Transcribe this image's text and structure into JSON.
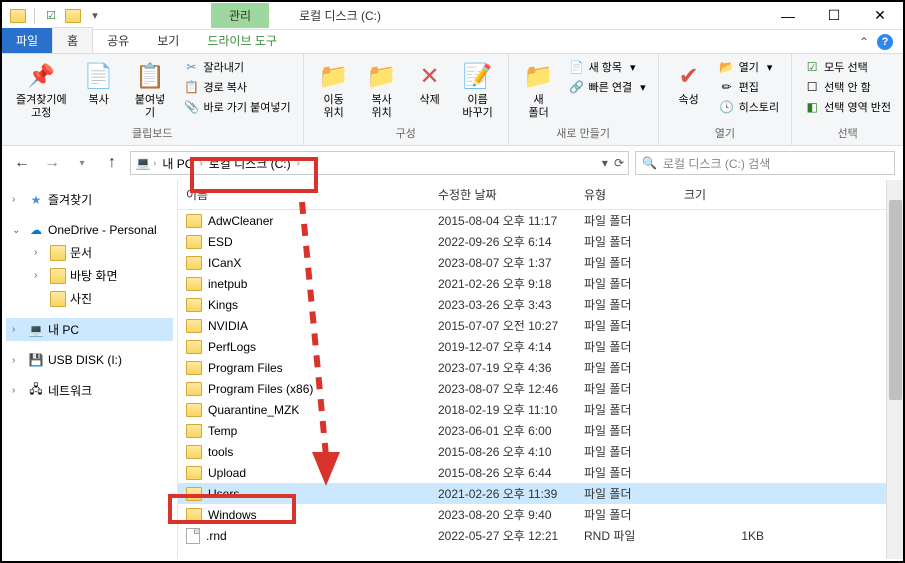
{
  "window_title": "로컬 디스크 (C:)",
  "title_tab": "관리",
  "tabs": {
    "file": "파일",
    "home": "홈",
    "share": "공유",
    "view": "보기",
    "drive_tools": "드라이브 도구"
  },
  "ribbon": {
    "clipboard": {
      "pin": "즐겨찾기에\n고정",
      "copy": "복사",
      "paste": "붙여넣기",
      "cut": "잘라내기",
      "copy_path": "경로 복사",
      "paste_shortcut": "바로 가기 붙여넣기",
      "label": "클립보드"
    },
    "organize": {
      "move_to": "이동\n위치",
      "copy_to": "복사\n위치",
      "delete": "삭제",
      "rename": "이름\n바꾸기",
      "label": "구성"
    },
    "new": {
      "new_folder": "새\n폴더",
      "new_item": "새 항목",
      "quick_access": "빠른 연결",
      "label": "새로 만들기"
    },
    "open": {
      "properties": "속성",
      "open": "열기",
      "edit": "편집",
      "history": "히스토리",
      "label": "열기"
    },
    "select": {
      "select_all": "모두 선택",
      "select_none": "선택 안 함",
      "invert": "선택 영역 반전",
      "label": "선택"
    }
  },
  "breadcrumb": {
    "my_pc": "내 PC",
    "drive": "로컬 디스크 (C:)"
  },
  "search_placeholder": "로컬 디스크 (C:) 검색",
  "columns": {
    "name": "이름",
    "date": "수정한 날짜",
    "type": "유형",
    "size": "크기"
  },
  "sidebar": {
    "quick_access": "즐겨찾기",
    "onedrive": "OneDrive - Personal",
    "documents": "문서",
    "desktop": "바탕 화면",
    "pictures": "사진",
    "my_pc": "내 PC",
    "usb": "USB DISK (I:)",
    "network": "네트워크"
  },
  "type_folder": "파일 폴더",
  "type_rnd": "RND 파일",
  "files": [
    {
      "name": "AdwCleaner",
      "date": "2015-08-04 오후 11:17",
      "type": "folder"
    },
    {
      "name": "ESD",
      "date": "2022-09-26 오후 6:14",
      "type": "folder"
    },
    {
      "name": "ICanX",
      "date": "2023-08-07 오후 1:37",
      "type": "folder"
    },
    {
      "name": "inetpub",
      "date": "2021-02-26 오후 9:18",
      "type": "folder"
    },
    {
      "name": "Kings",
      "date": "2023-03-26 오후 3:43",
      "type": "folder"
    },
    {
      "name": "NVIDIA",
      "date": "2015-07-07 오전 10:27",
      "type": "folder"
    },
    {
      "name": "PerfLogs",
      "date": "2019-12-07 오후 4:14",
      "type": "folder"
    },
    {
      "name": "Program Files",
      "date": "2023-07-19 오후 4:36",
      "type": "folder"
    },
    {
      "name": "Program Files (x86)",
      "date": "2023-08-07 오후 12:46",
      "type": "folder"
    },
    {
      "name": "Quarantine_MZK",
      "date": "2018-02-19 오후 11:10",
      "type": "folder"
    },
    {
      "name": "Temp",
      "date": "2023-06-01 오후 6:00",
      "type": "folder"
    },
    {
      "name": "tools",
      "date": "2015-08-26 오후 4:10",
      "type": "folder"
    },
    {
      "name": "Upload",
      "date": "2015-08-26 오후 6:44",
      "type": "folder"
    },
    {
      "name": "Users",
      "date": "2021-02-26 오후 11:39",
      "type": "folder",
      "selected": true
    },
    {
      "name": "Windows",
      "date": "2023-08-20 오후 9:40",
      "type": "folder"
    },
    {
      "name": ".rnd",
      "date": "2022-05-27 오후 12:21",
      "type": "file_rnd",
      "size": "1KB"
    }
  ]
}
